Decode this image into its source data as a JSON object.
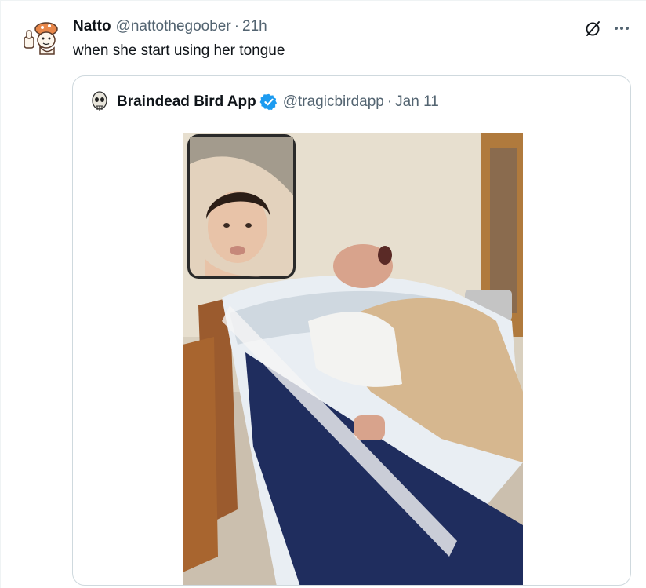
{
  "tweet": {
    "display_name": "Natto",
    "handle": "@nattothegoober",
    "separator": "·",
    "time": "21h",
    "text": "when she start using her tongue",
    "avatar_icon": "cartoon-thumbs-up-avatar-icon",
    "actions": {
      "grok_icon": "grok-slash-circle-icon",
      "more_icon": "more-dots-icon"
    }
  },
  "quote": {
    "display_name": "Braindead Bird App",
    "verified_icon": "verified-badge-icon",
    "verified_color": "#1d9bf0",
    "handle": "@tragicbirdapp",
    "separator": "·",
    "date": "Jan 11",
    "avatar_icon": "skull-avatar-icon",
    "media": {
      "kind": "photo",
      "inset": "front-camera video call overlay"
    }
  },
  "colors": {
    "text": "#0f1419",
    "muted": "#536471",
    "border": "#cfd9de",
    "accent": "#1d9bf0"
  }
}
